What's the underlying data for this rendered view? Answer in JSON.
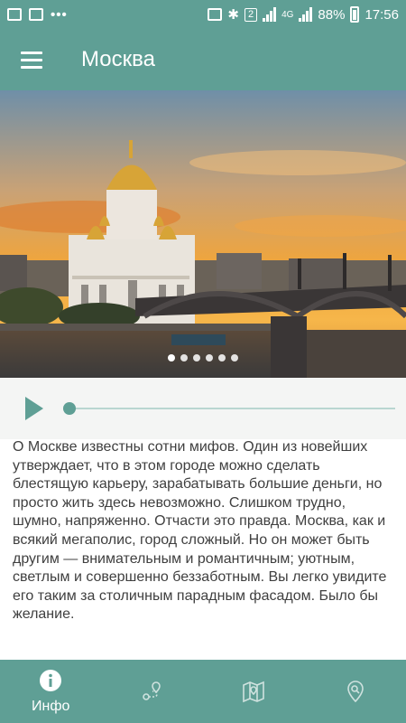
{
  "status_bar": {
    "battery": "88%",
    "time": "17:56",
    "network": "4G",
    "sim_badge": "2"
  },
  "app_bar": {
    "title": "Москва",
    "menu_icon": "hamburger-menu-icon"
  },
  "hero": {
    "slide_count": 6,
    "active_slide": 1
  },
  "player": {
    "play_icon": "play-icon",
    "progress": 0
  },
  "description": "О Москве известны сотни мифов. Один из новейших утверждает, что в этом городе можно сделать блестящую карьеру, зарабатывать большие деньги, но просто жить здесь невозможно. Слишком трудно, шумно, напряженно. Отчасти это правда. Москва, как и всякий мегаполис, город сложный. Но он может быть другим — внимательным и романтичным; уютным, светлым и совершенно беззаботным. Вы легко увидите его таким за столичным парадным фасадом. Было бы желание.",
  "bottom_nav": {
    "items": [
      {
        "label": "Инфо",
        "icon": "info-icon",
        "active": true
      },
      {
        "label": "",
        "icon": "route-icon",
        "active": false
      },
      {
        "label": "",
        "icon": "map-icon",
        "active": false
      },
      {
        "label": "",
        "icon": "location-search-icon",
        "active": false
      }
    ]
  },
  "colors": {
    "primary": "#5f9f95",
    "text": "#3f3f3f",
    "player_bg": "#f4f5f4"
  }
}
